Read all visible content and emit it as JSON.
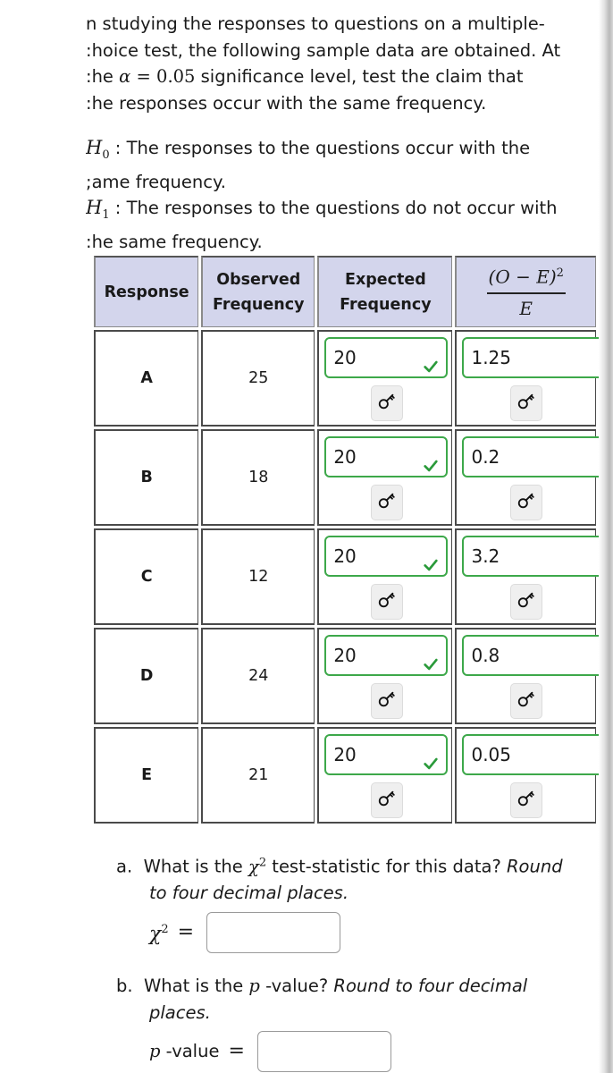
{
  "intro": {
    "line1": "n studying the responses to questions on a multiple-",
    "line2": ":hoice test, the following sample data are obtained. At",
    "line3_pre": ":he ",
    "alpha_symbol": "α",
    "alpha_eq": " = 0.05",
    "line3_post": " significance level, test the claim that",
    "line4": ":he responses occur with the same frequency."
  },
  "hypotheses": {
    "h0_symbol": "H",
    "h0_sub": "0",
    "h0_line1": " : The responses to the questions occur with the",
    "h0_line2": ";ame frequency.",
    "h1_symbol": "H",
    "h1_sub": "1",
    "h1_line1": " : The responses to the questions do not occur with",
    "h1_line2": ":he same frequency."
  },
  "table": {
    "headers": {
      "response": "Response",
      "observed_1": "Observed",
      "observed_2": "Frequency",
      "expected_1": "Expected",
      "expected_2": "Frequency",
      "chi_num": "(O − E)",
      "chi_num_exp": "2",
      "chi_den": "E"
    },
    "rows": [
      {
        "response": "A",
        "observed": "25",
        "expected": "20",
        "contribution": "1.25"
      },
      {
        "response": "B",
        "observed": "18",
        "expected": "20",
        "contribution": "0.2"
      },
      {
        "response": "C",
        "observed": "12",
        "expected": "20",
        "contribution": "3.2"
      },
      {
        "response": "D",
        "observed": "24",
        "expected": "20",
        "contribution": "0.8"
      },
      {
        "response": "E",
        "observed": "21",
        "expected": "20",
        "contribution": "0.05"
      }
    ],
    "correct_color": "#3da84a"
  },
  "question_a": {
    "prefix": "a.",
    "text_pre": "What is the ",
    "chi": "χ",
    "chi_exp": "2",
    "text_post": " test-statistic for this data? ",
    "italic_1": "Round",
    "italic_2": "to four decimal places.",
    "label_chi": "χ",
    "label_exp": "2",
    "equals": "=",
    "value": ""
  },
  "question_b": {
    "prefix": "b.",
    "text_pre": "What is the ",
    "p": "p",
    "text_mid": " -value? ",
    "italic_1": "Round to four decimal",
    "italic_2": "places.",
    "label_p": "p",
    "label_text": " -value",
    "equals": "=",
    "value": ""
  }
}
